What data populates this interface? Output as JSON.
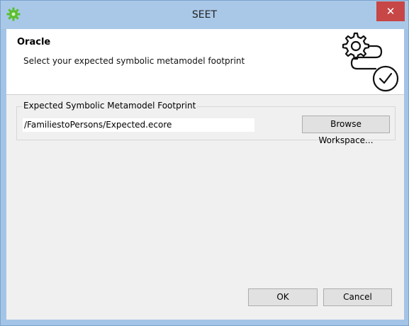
{
  "window": {
    "title": "SEET",
    "close_label": "✕"
  },
  "header": {
    "title": "Oracle",
    "description": "Select your expected symbolic metamodel footprint"
  },
  "group": {
    "legend": "Expected Symbolic Metamodel Footprint",
    "path_value": "/FamiliestoPersons/Expected.ecore",
    "browse_label": "Browse Workspace..."
  },
  "buttons": {
    "ok_label": "OK",
    "cancel_label": "Cancel"
  },
  "colors": {
    "titlebar": "#a9c8e8",
    "close": "#c74646",
    "app_icon": "#5bbf2f"
  }
}
